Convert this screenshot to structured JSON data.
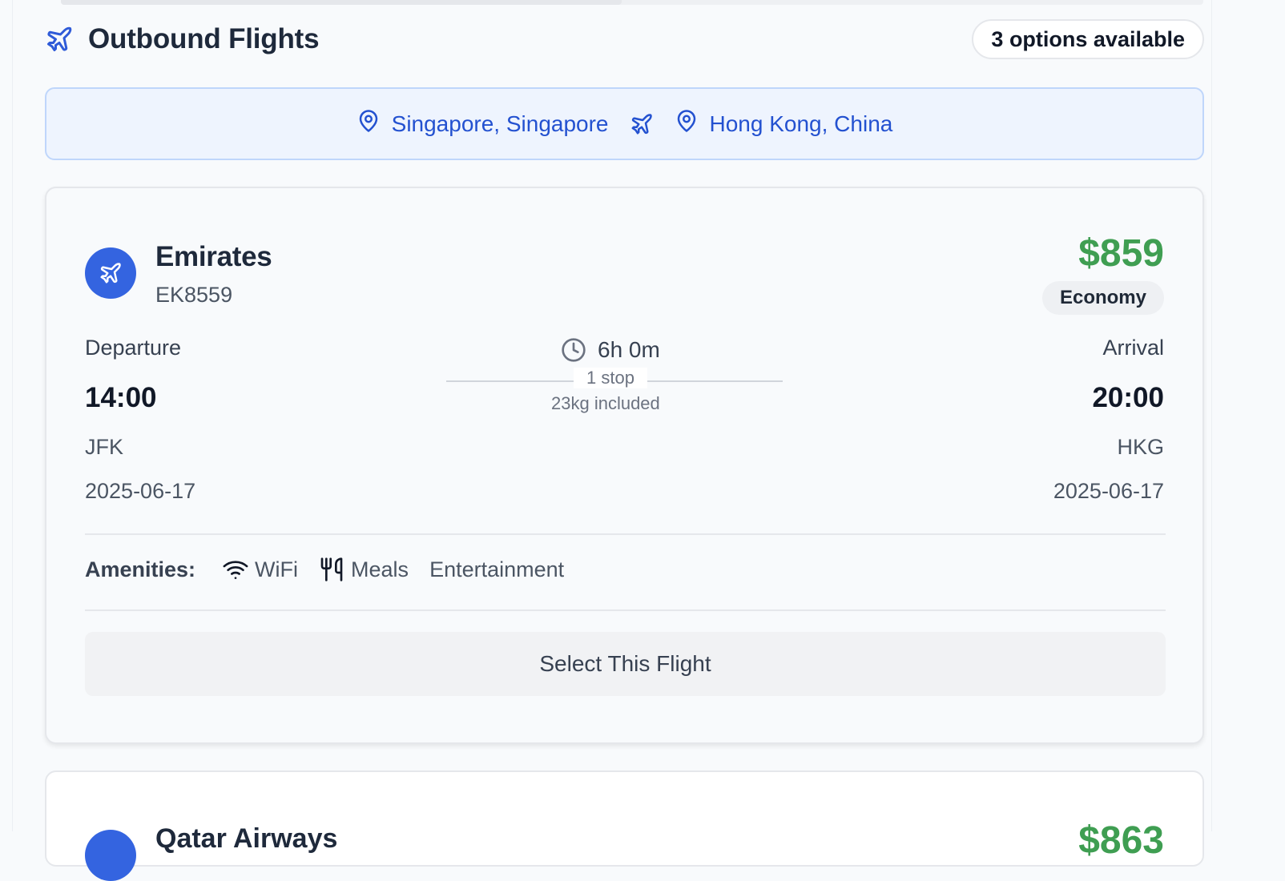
{
  "header": {
    "title": "Outbound Flights",
    "options_badge": "3 options available"
  },
  "route": {
    "from": "Singapore, Singapore",
    "to": "Hong Kong, China"
  },
  "flights": [
    {
      "airline": "Emirates",
      "flight_number": "EK8559",
      "price": "$859",
      "cabin": "Economy",
      "departure_label": "Departure",
      "arrival_label": "Arrival",
      "departure_time": "14:00",
      "arrival_time": "20:00",
      "departure_airport": "JFK",
      "arrival_airport": "HKG",
      "departure_date": "2025-06-17",
      "arrival_date": "2025-06-17",
      "duration": "6h 0m",
      "stops": "1 stop",
      "baggage": "23kg included",
      "amenities_label": "Amenities:",
      "amenities": [
        "WiFi",
        "Meals",
        "Entertainment"
      ],
      "select_label": "Select This Flight"
    },
    {
      "airline": "Qatar Airways",
      "price": "$863"
    }
  ],
  "colors": {
    "accent": "#2f5bd8",
    "price": "#3f9e52",
    "route_bg": "#eef4fe"
  }
}
